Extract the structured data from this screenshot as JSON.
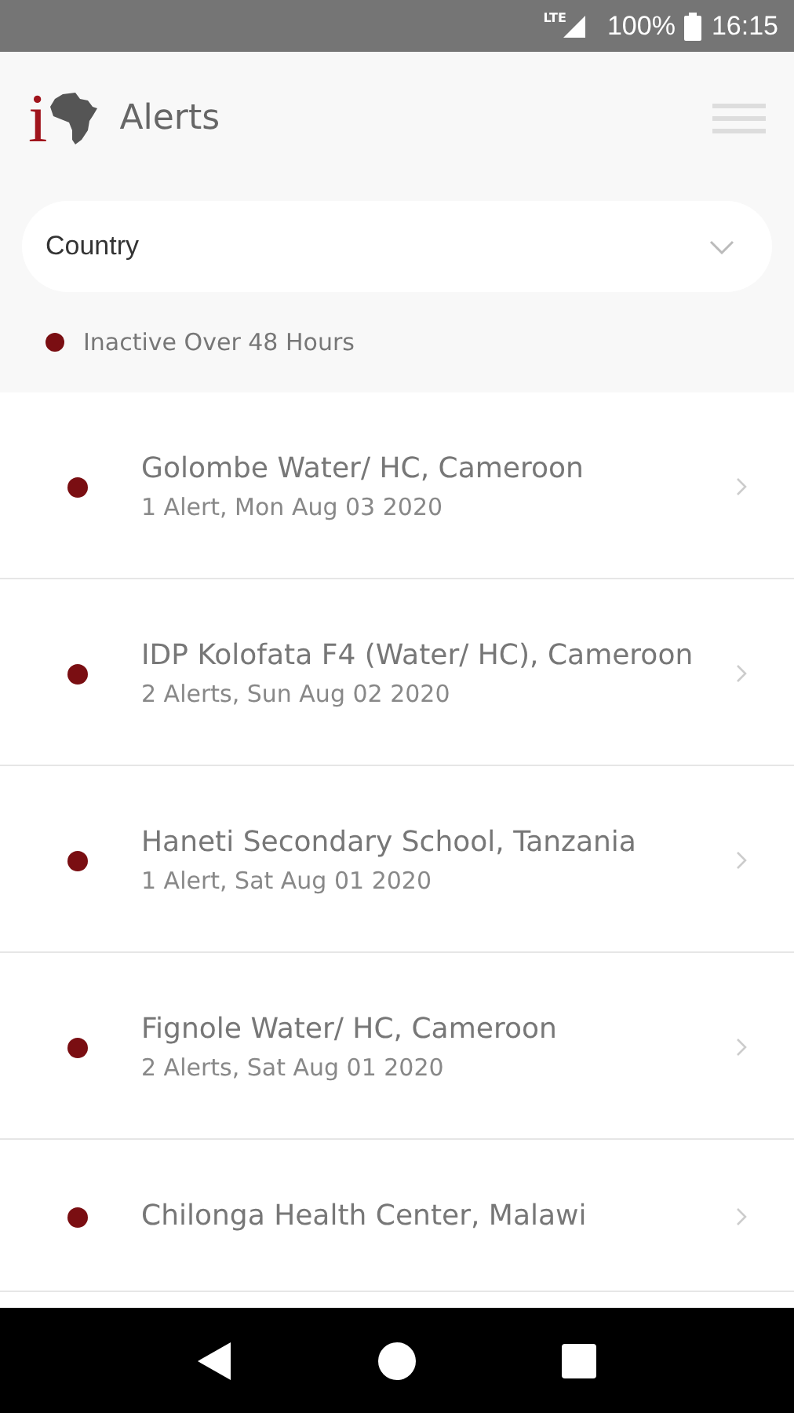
{
  "status_bar": {
    "network": "LTE",
    "battery": "100%",
    "time": "16:15"
  },
  "header": {
    "logo_letter": "i",
    "title": "Alerts"
  },
  "filter": {
    "placeholder": "Country"
  },
  "legend": {
    "label": "Inactive Over 48 Hours",
    "color": "#7a0e12"
  },
  "alerts": [
    {
      "title": "Golombe Water/ HC, Cameroon",
      "subtitle": "1 Alert, Mon Aug 03 2020",
      "color": "#7a0e12"
    },
    {
      "title": "IDP Kolofata F4 (Water/ HC), Cameroon",
      "subtitle": "2 Alerts, Sun Aug 02 2020",
      "color": "#7a0e12"
    },
    {
      "title": "Haneti Secondary School, Tanzania",
      "subtitle": "1 Alert, Sat Aug 01 2020",
      "color": "#7a0e12"
    },
    {
      "title": "Fignole Water/ HC, Cameroon",
      "subtitle": "2 Alerts, Sat Aug 01 2020",
      "color": "#7a0e12"
    },
    {
      "title": "Chilonga Health Center, Malawi",
      "color": "#7a0e12"
    }
  ]
}
